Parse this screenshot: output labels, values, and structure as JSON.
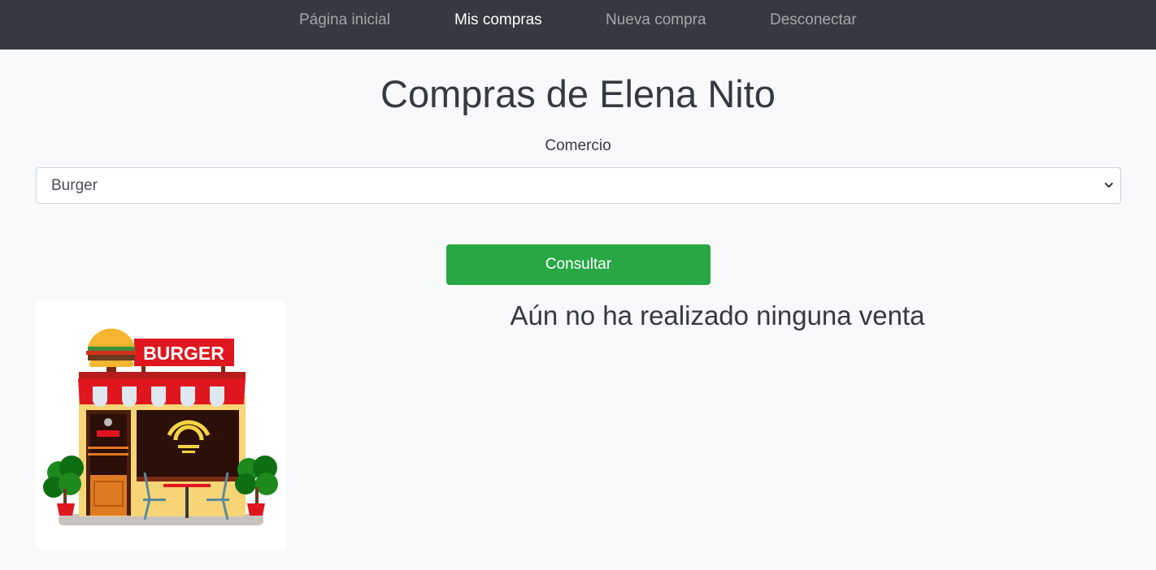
{
  "nav": {
    "items": [
      {
        "label": "Página inicial",
        "active": false
      },
      {
        "label": "Mis compras",
        "active": true
      },
      {
        "label": "Nueva compra",
        "active": false
      },
      {
        "label": "Desconectar",
        "active": false
      }
    ]
  },
  "page": {
    "title": "Compras de Elena Nito"
  },
  "form": {
    "label": "Comercio",
    "selected": "Burger",
    "submit_label": "Consultar"
  },
  "image": {
    "sign_text": "BURGER"
  },
  "result": {
    "message": "Aún no ha realizado ninguna venta"
  },
  "colors": {
    "navbar": "#343a40",
    "button": "#28a745",
    "background": "#f8f9fa"
  }
}
